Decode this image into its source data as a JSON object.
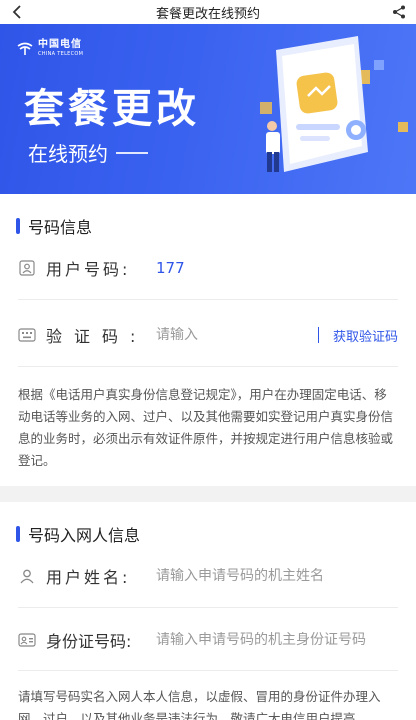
{
  "nav": {
    "title": "套餐更改在线预约"
  },
  "banner": {
    "logo_cn": "中国电信",
    "logo_en": "CHINA TELECOM",
    "headline": "套餐更改",
    "subline": "在线预约"
  },
  "number_info": {
    "title": "号码信息",
    "user_number_label": "用户号码:",
    "user_number_value": "177",
    "verify_label": "验证码:",
    "verify_placeholder": "请输入",
    "get_code_label": "获取验证码",
    "notice": "根据《电话用户真实身份信息登记规定》，用户在办理固定电话、移动电话等业务的入网、过户、以及其他需要如实登记用户真实身份信息的业务时，必须出示有效证件原件，并按规定进行用户信息核验或登记。"
  },
  "owner_info": {
    "title": "号码入网人信息",
    "name_label": "用户姓名:",
    "name_placeholder": "请输入申请号码的机主姓名",
    "id_label": "身份证号码:",
    "id_placeholder": "请输入申请号码的机主身份证号码",
    "notice": "请填写号码实名入网人本人信息，以虚假、冒用的身份证件办理入网、过户、以及其他业务是违法行为，敬请广大电信用户提高"
  },
  "colors": {
    "accent": "#2f55e8",
    "banner_start": "#2f55e8",
    "banner_end": "#4d76f7"
  },
  "icons": [
    "back-icon",
    "share-icon",
    "user-card-icon",
    "keyboard-icon",
    "person-icon",
    "id-card-icon"
  ]
}
